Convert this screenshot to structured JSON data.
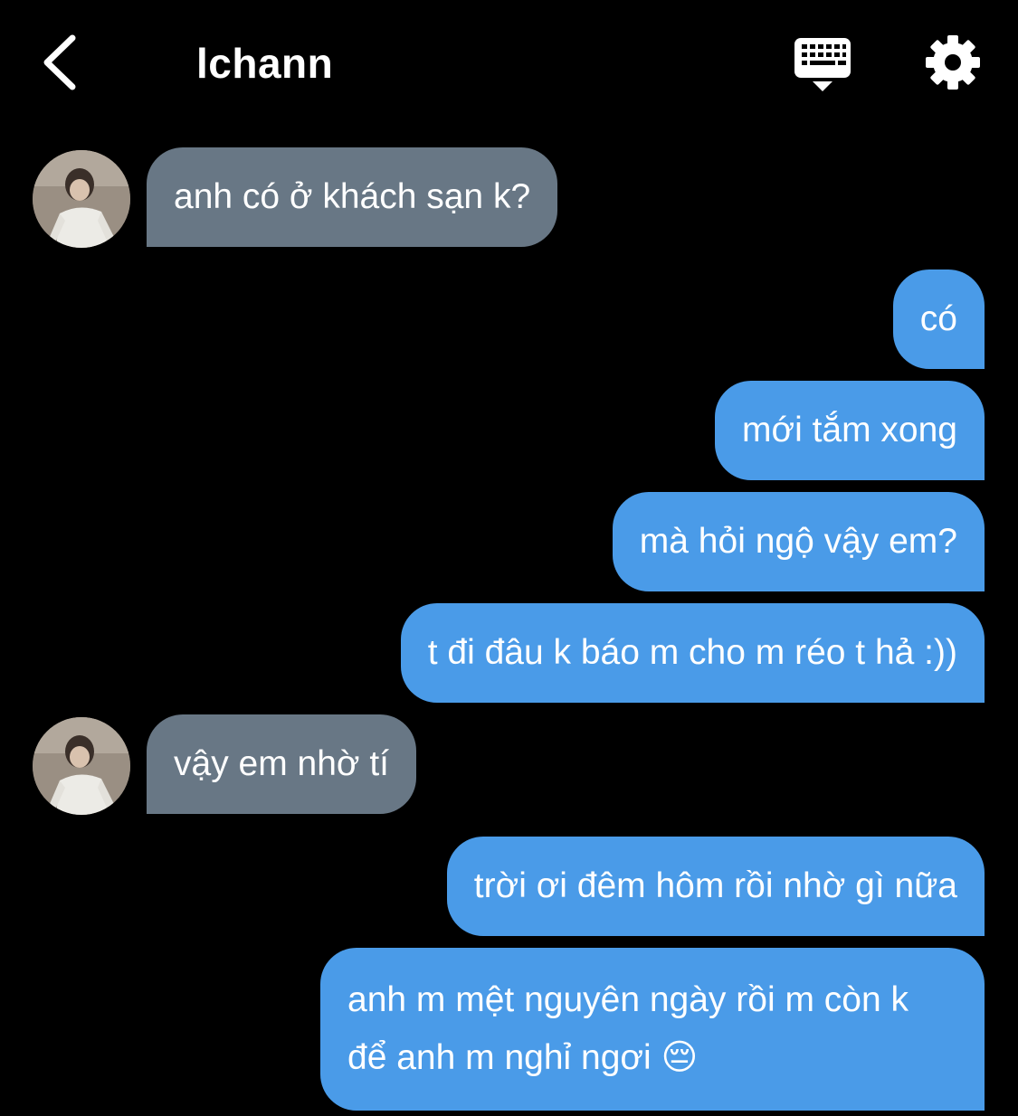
{
  "header": {
    "title": "lchann",
    "back_icon": "chevron-left-icon",
    "keyboard_icon": "keyboard-icon",
    "settings_icon": "gear-icon"
  },
  "messages": [
    {
      "sender": "them",
      "text": "anh có ở khách sạn k?"
    },
    {
      "sender": "me",
      "text": "có"
    },
    {
      "sender": "me",
      "text": "mới tắm xong"
    },
    {
      "sender": "me",
      "text": "mà hỏi ngộ vậy em?"
    },
    {
      "sender": "me",
      "text": "t đi đâu k báo m cho m réo t hả :))"
    },
    {
      "sender": "them",
      "text": "vậy em nhờ tí"
    },
    {
      "sender": "me",
      "text": "trời ơi đêm hôm rồi nhờ gì nữa"
    },
    {
      "sender": "me",
      "text": "anh m mệt nguyên ngày rồi m còn k để anh m nghỉ ngơi 😔"
    }
  ],
  "colors": {
    "background": "#000000",
    "incoming_bubble": "#687785",
    "outgoing_bubble": "#4a9be8",
    "text": "#ffffff"
  }
}
